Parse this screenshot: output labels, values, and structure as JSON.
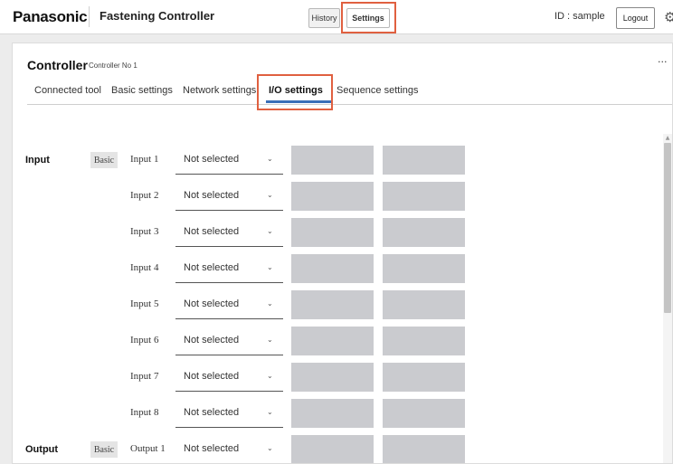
{
  "header": {
    "brand": "Panasonic",
    "app_title": "Fastening Controller",
    "nav_history": "History",
    "nav_settings": "Settings",
    "user_id": "ID : sample",
    "logout": "Logout"
  },
  "controller": {
    "title": "Controller",
    "subtitle": "Controller No 1",
    "more": "···"
  },
  "tabs": [
    {
      "label": "Connected tool"
    },
    {
      "label": "Basic settings"
    },
    {
      "label": "Network settings"
    },
    {
      "label": "I/O settings",
      "active": true
    },
    {
      "label": "Sequence settings"
    }
  ],
  "io": {
    "input_label": "Input",
    "output_label": "Output",
    "badge": "Basic",
    "select_default": "Not selected",
    "rows": [
      {
        "label": "Input 1",
        "value": "Not selected"
      },
      {
        "label": "Input 2",
        "value": "Not selected"
      },
      {
        "label": "Input 3",
        "value": "Not selected"
      },
      {
        "label": "Input 4",
        "value": "Not selected"
      },
      {
        "label": "Input 5",
        "value": "Not selected"
      },
      {
        "label": "Input 6",
        "value": "Not selected"
      },
      {
        "label": "Input 7",
        "value": "Not selected"
      },
      {
        "label": "Input 8",
        "value": "Not selected"
      },
      {
        "label": "Output 1",
        "value": "Not selected"
      }
    ]
  },
  "colors": {
    "highlight": "#e06040",
    "tab_underline": "#3a6fb8",
    "value_box": "#cacbcf"
  }
}
